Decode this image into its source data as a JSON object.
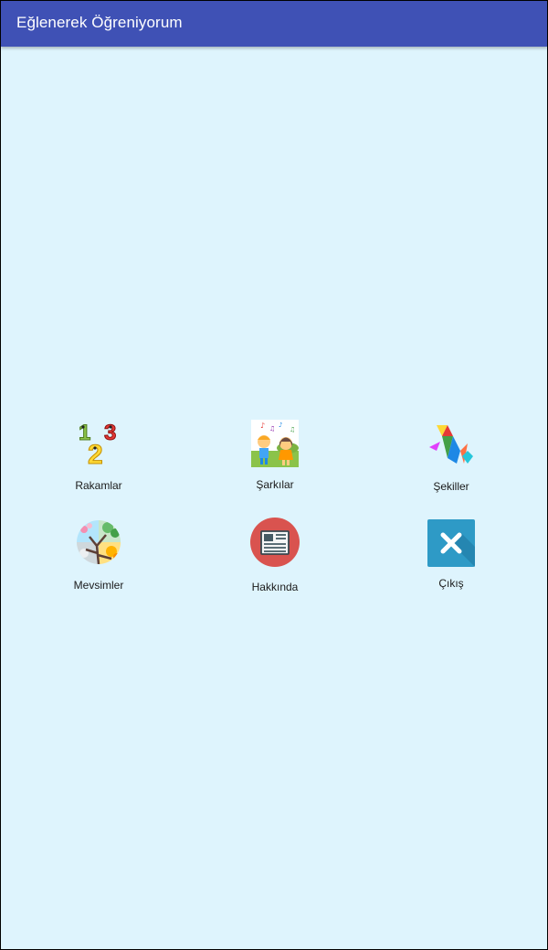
{
  "app": {
    "title": "Eğlenerek Öğreniyorum"
  },
  "menu": {
    "items": [
      {
        "label": "Rakamlar",
        "icon": "numbers-123-icon"
      },
      {
        "label": "Şarkılar",
        "icon": "singing-kids-icon"
      },
      {
        "label": "Şekiller",
        "icon": "tangram-shapes-icon"
      },
      {
        "label": "Mevsimler",
        "icon": "seasons-tree-icon"
      },
      {
        "label": "Hakkında",
        "icon": "newspaper-icon"
      },
      {
        "label": "Çıkış",
        "icon": "close-icon"
      }
    ]
  },
  "colors": {
    "app_bar": "#3f51b5",
    "background": "#def4fd",
    "about_circle": "#d9534f",
    "exit_tile": "#2e9ac6"
  }
}
